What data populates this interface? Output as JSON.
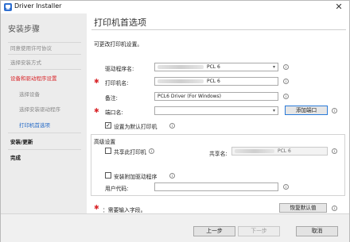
{
  "window": {
    "title": "Driver Installer",
    "close_glyph": "✕"
  },
  "sidebar": {
    "title": "安装步骤",
    "items": [
      {
        "label": "同意使用许可协议",
        "state": "done"
      },
      {
        "label": "选择安装方式",
        "state": "done"
      },
      {
        "label": "设备和驱动程序设置",
        "state": "active"
      },
      {
        "label": "选择设备",
        "state": "done"
      },
      {
        "label": "选择安装驱动程序",
        "state": "done"
      },
      {
        "label": "打印机首选项",
        "state": "current"
      },
      {
        "label": "安装/更新",
        "state": "pending"
      },
      {
        "label": "完成",
        "state": "pending"
      }
    ]
  },
  "main": {
    "title": "打印机首选项",
    "intro": "可更改打印机设置。",
    "driver_label": "驱动程序名:",
    "driver_value": "PCL 6",
    "printer_name_label": "打印机名:",
    "printer_name_value": "PCL 6",
    "comment_label": "备注:",
    "comment_value": "PCL6 Driver (For Windows)",
    "port_label": "端口名:",
    "port_value": "",
    "add_port_button": "添加端口",
    "default_printer_label": "设置为默认打印机",
    "default_printer_checked": true,
    "advanced": {
      "title": "高级设置",
      "share_label": "共享此打印机",
      "share_checked": false,
      "share_name_label": "共享名:",
      "share_name_value": "PCL 6",
      "additional_driver_label": "安装附加驱动程序",
      "additional_driver_checked": false,
      "user_code_label": "用户代码:",
      "user_code_value": ""
    },
    "required_note": "：需要输入字段。",
    "restore_defaults_button": "恢复默认值",
    "info_glyph": "i",
    "required_glyph": "✱",
    "dropdown_glyph": "▾"
  },
  "footer": {
    "back_button": "上一步",
    "next_button": "下一步",
    "cancel_button": "取消"
  },
  "colors": {
    "required": "#d9262a",
    "current_step": "#2268c6",
    "accent_border": "#2a7ad8"
  }
}
